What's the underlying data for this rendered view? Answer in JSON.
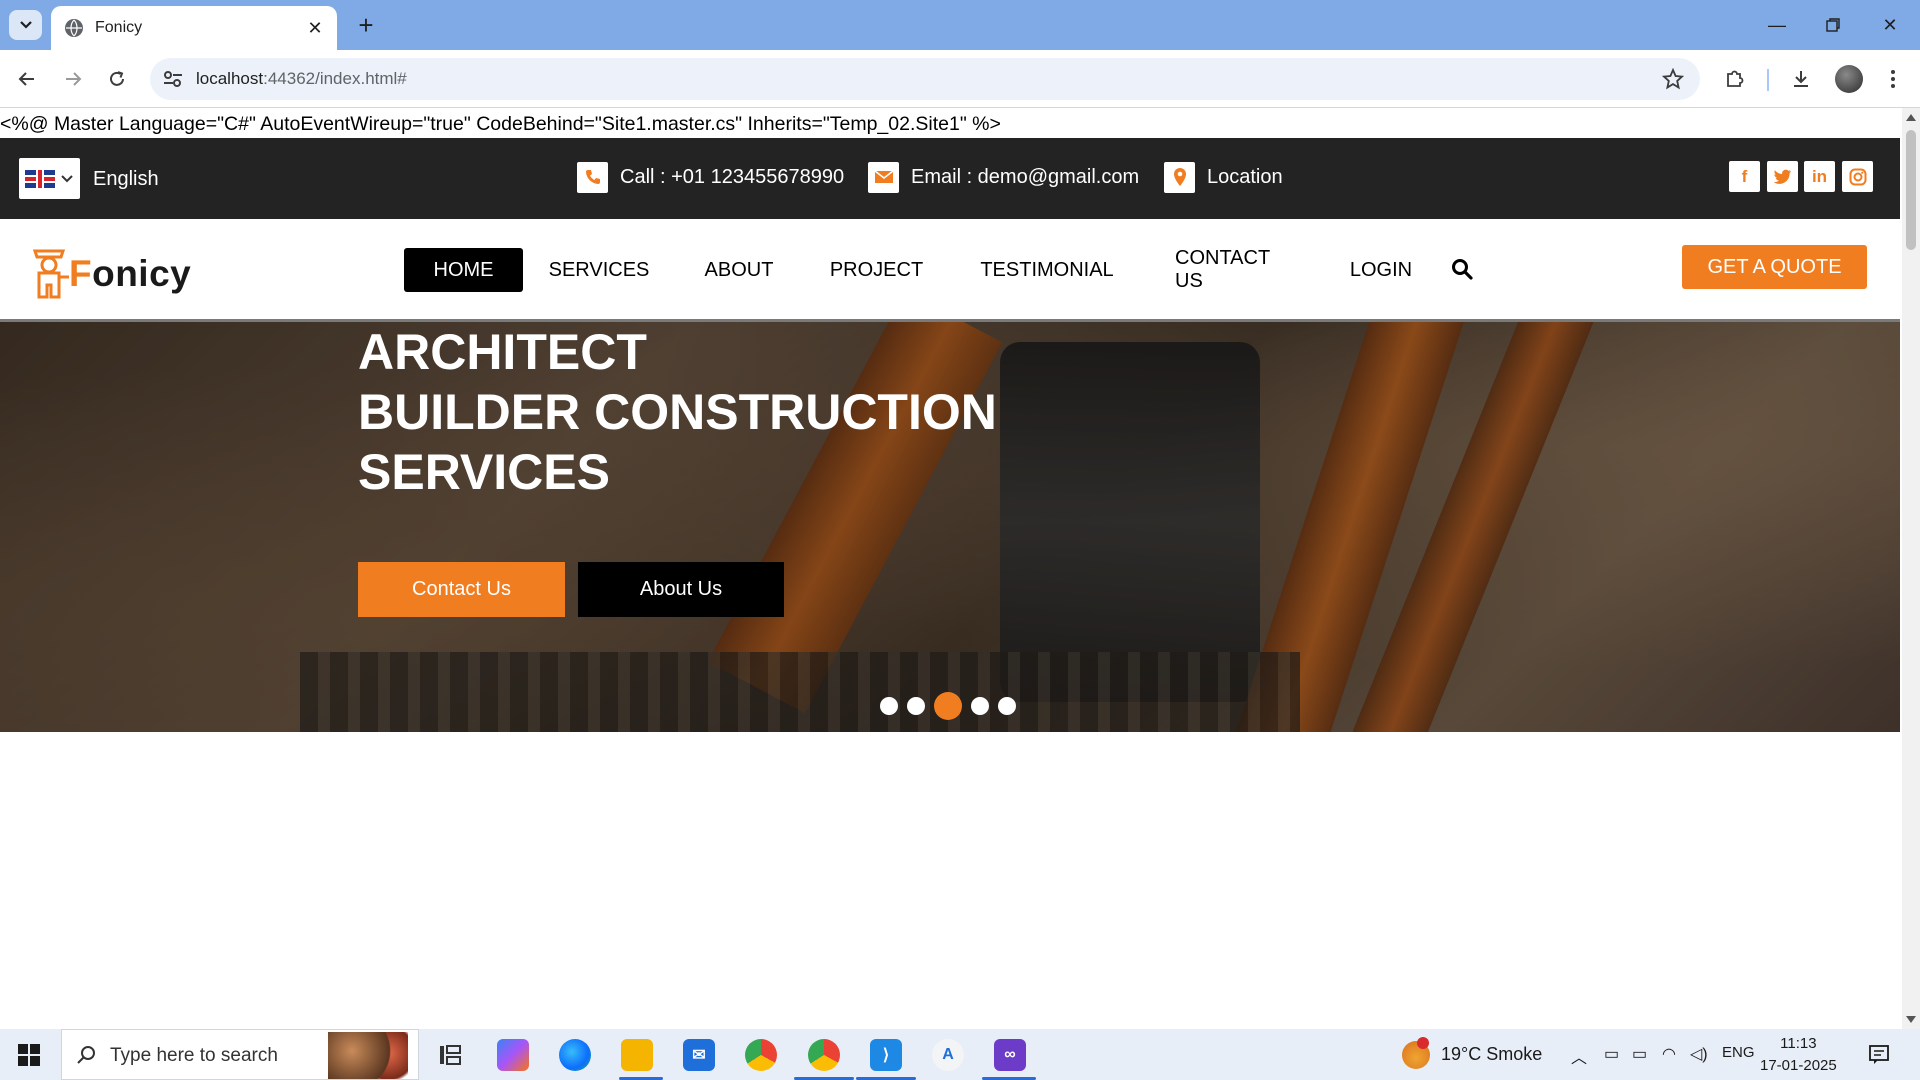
{
  "browser": {
    "tab_title": "Fonicy",
    "url_host": "localhost",
    "url_rest": ":44362/index.html#"
  },
  "page": {
    "directive_text": "<%@ Master Language=\"C#\" AutoEventWireup=\"true\" CodeBehind=\"Site1.master.cs\" Inherits=\"Temp_02.Site1\" %>",
    "topbar": {
      "language": "English",
      "call": "Call : +01 123455678990",
      "email": "Email : demo@gmail.com",
      "location": "Location",
      "socials": [
        "facebook-icon",
        "twitter-icon",
        "linkedin-icon",
        "instagram-icon"
      ]
    },
    "logo_text": "Fonicy",
    "nav": {
      "items": [
        "HOME",
        "SERVICES",
        "ABOUT",
        "PROJECT",
        "TESTIMONIAL",
        "CONTACT US",
        "LOGIN"
      ],
      "active": "HOME",
      "quote_button": "GET A QUOTE"
    },
    "hero": {
      "title_lines": [
        "ARCHITECT",
        "BUILDER CONSTRUCTION",
        "SERVICES"
      ],
      "primary_button": "Contact Us",
      "secondary_button": "About Us",
      "slides_count": 5,
      "active_slide": 3
    },
    "colors": {
      "accent": "#f07d1f",
      "topbar_bg": "#232323"
    }
  },
  "taskbar": {
    "search_placeholder": "Type here to search",
    "weather": "19°C  Smoke",
    "language": "ENG",
    "time": "11:13",
    "date": "17-01-2025"
  }
}
